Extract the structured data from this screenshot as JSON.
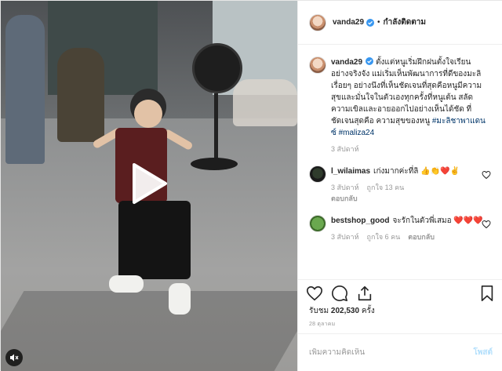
{
  "header": {
    "username": "vanda29",
    "follow_status": "กำลังติดตาม"
  },
  "caption": {
    "username": "vanda29",
    "text": "ตั้งแต่หนูเริ่มฝึกฝนตั้งใจเรียนอย่างจริงจัง แม่เริ่มเห็นพัฒนาการที่ดีของมะลิเรื่อยๆ อย่างนึงที่เห็นชัดเจนที่สุดคือหนูมีความสุขและมั่นใจในตัวเองทุกครั้งที่หนูเต้น สลัดความเขิลและอายออกไปอย่างเห็นได้ชัด ที่ชัดเจนสุดคือ ความสุขของหนู",
    "hashtags": "#มะลิชาพาแดนซ์ #maliza24",
    "time": "3 สัปดาห์"
  },
  "comments": [
    {
      "username": "l_wilaimas",
      "text": "เก่งมากค่ะที่ลิ 👍👏❤️✌️",
      "time": "3 สัปดาห์",
      "likes": "ถูกใจ 13 คน",
      "reply": "ตอบกลับ"
    },
    {
      "username": "bestshop_good",
      "text": "จะรักในตัวพี่เสมอ ❤️❤️❤️",
      "time": "3 สัปดาห์",
      "likes": "ถูกใจ 6 คน",
      "reply": "ตอบกลับ"
    }
  ],
  "stats": {
    "views_label": "รับชม",
    "views_count": "202,530",
    "views_suffix": "ครั้ง",
    "date": "28 ตุลาคม"
  },
  "add_comment": {
    "placeholder": "เพิ่มความคิดเห็น",
    "post_label": "โพสต์"
  },
  "icons": {
    "play": "play-icon",
    "sound": "speaker-icon",
    "like": "heart-icon",
    "comment": "comment-icon",
    "share": "share-icon",
    "save": "bookmark-icon",
    "verified": "verified-badge-icon"
  },
  "colors": {
    "link": "#003569",
    "verified": "#3897f0",
    "post_button_disabled": "#b2dffc",
    "meta": "#999999"
  }
}
